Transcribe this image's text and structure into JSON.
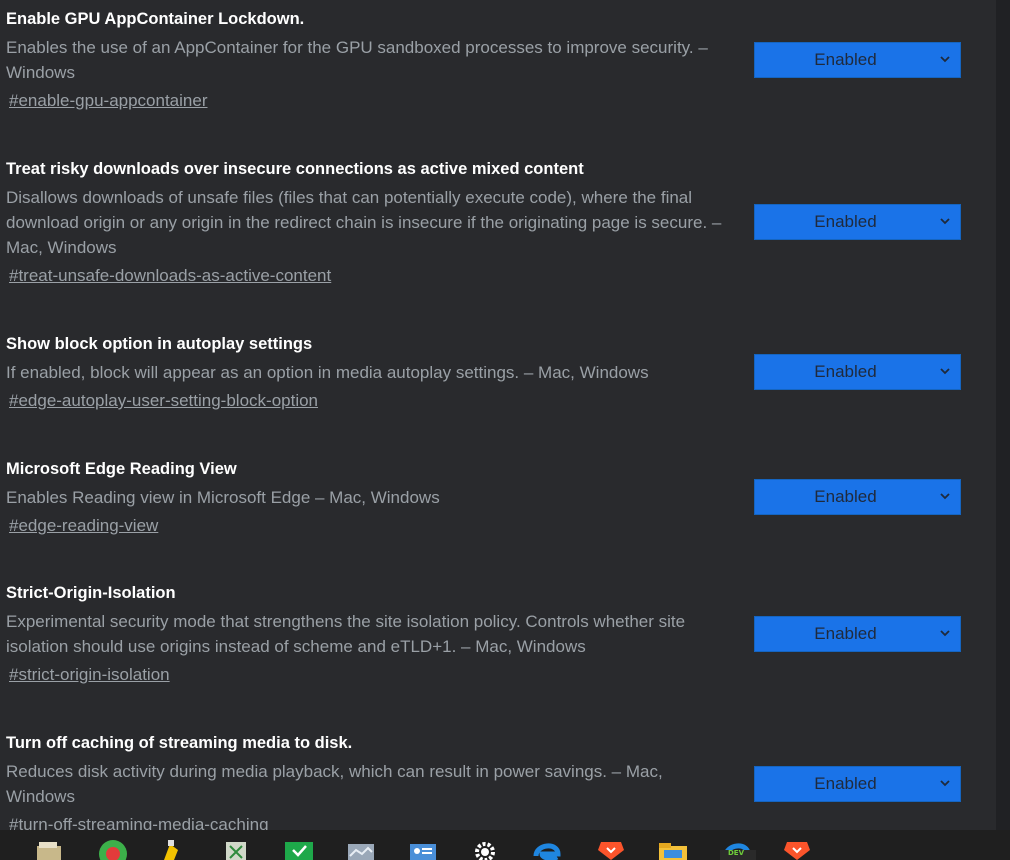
{
  "flags": [
    {
      "title": "Enable GPU AppContainer Lockdown.",
      "description": "Enables the use of an AppContainer for the GPU sandboxed processes to improve security. – Windows",
      "link": "#enable-gpu-appcontainer",
      "select_value": "Enabled"
    },
    {
      "title": "Treat risky downloads over insecure connections as active mixed content",
      "description": "Disallows downloads of unsafe files (files that can potentially execute code), where the final download origin or any origin in the redirect chain is insecure if the originating page is secure. – Mac, Windows",
      "link": "#treat-unsafe-downloads-as-active-content",
      "select_value": "Enabled"
    },
    {
      "title": "Show block option in autoplay settings",
      "description": "If enabled, block will appear as an option in media autoplay settings. – Mac, Windows",
      "link": "#edge-autoplay-user-setting-block-option",
      "select_value": "Enabled"
    },
    {
      "title": "Microsoft Edge Reading View",
      "description": "Enables Reading view in Microsoft Edge – Mac, Windows",
      "link": "#edge-reading-view",
      "select_value": "Enabled"
    },
    {
      "title": "Strict-Origin-Isolation",
      "description": "Experimental security mode that strengthens the site isolation policy. Controls whether site isolation should use origins instead of scheme and eTLD+1. – Mac, Windows",
      "link": "#strict-origin-isolation",
      "select_value": "Enabled"
    },
    {
      "title": "Turn off caching of streaming media to disk.",
      "description": "Reduces disk activity during media playback, which can result in power savings. – Mac, Windows",
      "link": "#turn-off-streaming-media-caching",
      "select_value": "Enabled"
    }
  ],
  "taskbar": {
    "icons": [
      "file-manager-icon",
      "stop-app-icon",
      "highlighter-app-icon",
      "spreadsheet-app-icon",
      "shield-check-icon",
      "photos-app-icon",
      "contacts-app-icon",
      "settings-gear-icon",
      "edge-browser-icon",
      "brave-browser-icon",
      "file-explorer-icon",
      "edge-dev-browser-icon",
      "brave-browser-2-icon"
    ],
    "edge_dev_badge": "DEV"
  },
  "colors": {
    "background": "#292a2d",
    "title": "#ffffff",
    "description": "#9aa0a6",
    "select_bg": "#1a73e8"
  }
}
